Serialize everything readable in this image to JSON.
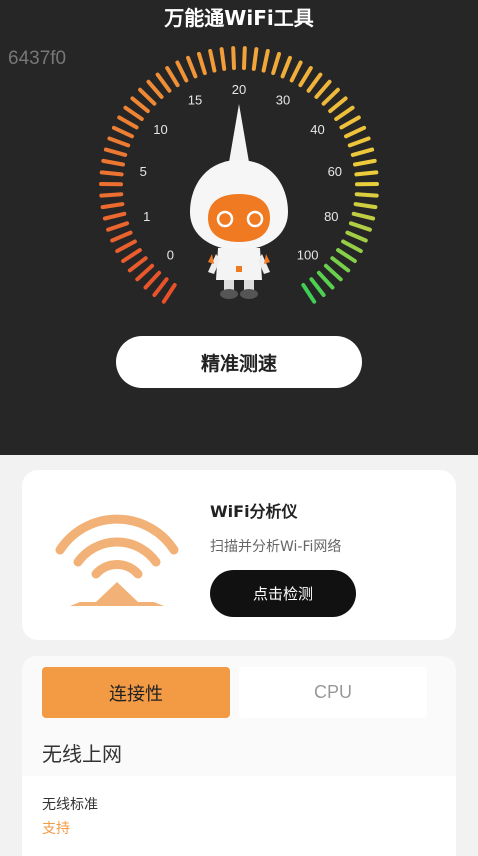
{
  "header": {
    "title": "万能通WiFi工具",
    "device_id": "6437f0"
  },
  "gauge": {
    "labels": [
      "0",
      "1",
      "5",
      "10",
      "15",
      "20",
      "30",
      "40",
      "60",
      "80",
      "100"
    ],
    "colors": {
      "start": "#e8502a",
      "mid": "#f2a23a",
      "end": "#3fcf52"
    }
  },
  "speed_test": {
    "button_label": "精准测速"
  },
  "wifi_card": {
    "title": "WiFi分析仪",
    "subtitle": "扫描并分析Wi-Fi网络",
    "button_label": "点击检测",
    "icon": "wifi-signal-tower-icon",
    "icon_color": "#f2b277"
  },
  "tabs": [
    {
      "label": "连接性",
      "active": true
    },
    {
      "label": "CPU",
      "active": false
    }
  ],
  "section": {
    "title": "无线上网",
    "rows": [
      {
        "label": "无线标准",
        "value": "支持"
      }
    ]
  }
}
